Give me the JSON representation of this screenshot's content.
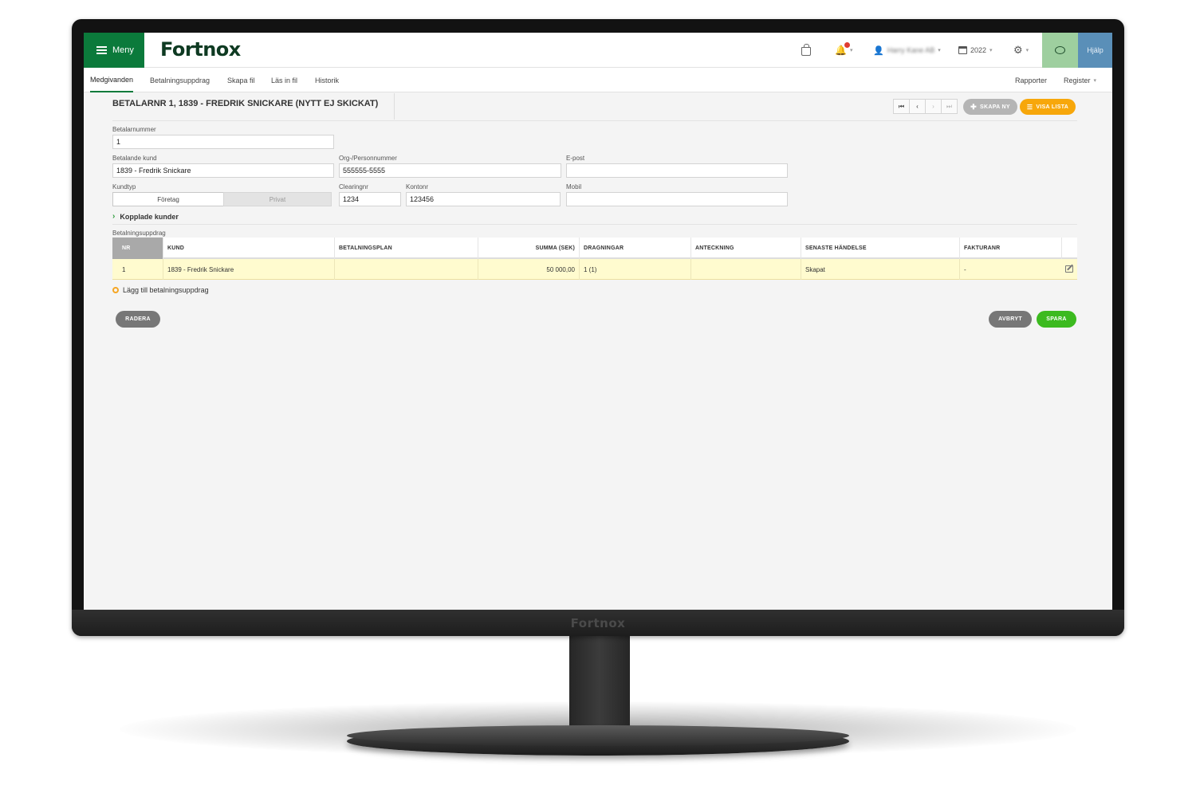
{
  "monitor": {
    "brand": "Fortnox"
  },
  "topbar": {
    "menu_label": "Meny",
    "logo_text": "Fortnox",
    "user_name": "Harry Kane AB",
    "year": "2022",
    "help_label": "Hjälp"
  },
  "subnav": {
    "tabs": [
      {
        "label": "Medgivanden"
      },
      {
        "label": "Betalningsuppdrag"
      },
      {
        "label": "Skapa fil"
      },
      {
        "label": "Läs in fil"
      },
      {
        "label": "Historik"
      }
    ],
    "active_tab": "Medgivanden",
    "right_links": [
      {
        "label": "Rapporter"
      },
      {
        "label": "Register"
      }
    ]
  },
  "header": {
    "title": "BETALARNR 1, 1839 - FREDRIK SNICKARE (NYTT EJ SKICKAT)",
    "create_new_label": "SKAPA NY",
    "show_list_label": "VISA LISTA"
  },
  "form": {
    "payer_number": {
      "label": "Betalarnummer",
      "value": "1"
    },
    "paying_customer": {
      "label": "Betalande kund",
      "value": "1839 - Fredrik Snickare"
    },
    "org_number": {
      "label": "Org-/Personnummer",
      "value": "555555-5555"
    },
    "email": {
      "label": "E-post",
      "value": ""
    },
    "customer_type": {
      "label": "Kundtyp",
      "options": [
        "Företag",
        "Privat"
      ],
      "selected": "Företag"
    },
    "clearing": {
      "label": "Clearingnr",
      "value": "1234"
    },
    "account": {
      "label": "Kontonr",
      "value": "123456"
    },
    "mobile": {
      "label": "Mobil",
      "value": ""
    },
    "linked_customers_label": "Kopplade kunder"
  },
  "table": {
    "label": "Betalningsuppdrag",
    "columns": [
      "NR",
      "KUND",
      "BETALNINGSPLAN",
      "SUMMA (SEK)",
      "DRAGNINGAR",
      "ANTECKNING",
      "SENASTE HÄNDELSE",
      "FAKTURANR"
    ],
    "rows": [
      {
        "nr": "1",
        "kund": "1839 - Fredrik Snickare",
        "betalningsplan": "",
        "summa": "50 000,00",
        "dragningar": "1 (1)",
        "anteckning": "",
        "senaste": "Skapat",
        "fakturanr": "-"
      }
    ],
    "add_label": "Lägg till betalningsuppdrag"
  },
  "actions": {
    "delete_label": "RADERA",
    "cancel_label": "AVBRYT",
    "save_label": "SPARA"
  },
  "colors": {
    "brand_green": "#0b7a3b",
    "save_green": "#3cba1f",
    "orange": "#f7a70b",
    "row_highlight": "#fffbcf"
  }
}
